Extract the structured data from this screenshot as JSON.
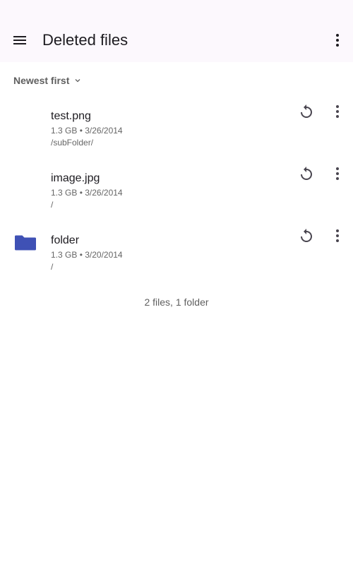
{
  "header": {
    "title": "Deleted files",
    "menu_icon": "menu-icon",
    "more_icon": "more-vert-icon"
  },
  "sort": {
    "label": "Newest first",
    "icon": "chevron-down-icon"
  },
  "items": [
    {
      "name": "test.png",
      "meta": "1.3 GB • 3/26/2014",
      "path": "/subFolder/",
      "type": "file"
    },
    {
      "name": "image.jpg",
      "meta": "1.3 GB • 3/26/2014",
      "path": "/",
      "type": "file"
    },
    {
      "name": "folder",
      "meta": "1.3 GB • 3/20/2014",
      "path": "/",
      "type": "folder"
    }
  ],
  "summary": "2 files, 1 folder",
  "colors": {
    "folder": "#3F51B5",
    "appbar": "#fcf8fd"
  }
}
